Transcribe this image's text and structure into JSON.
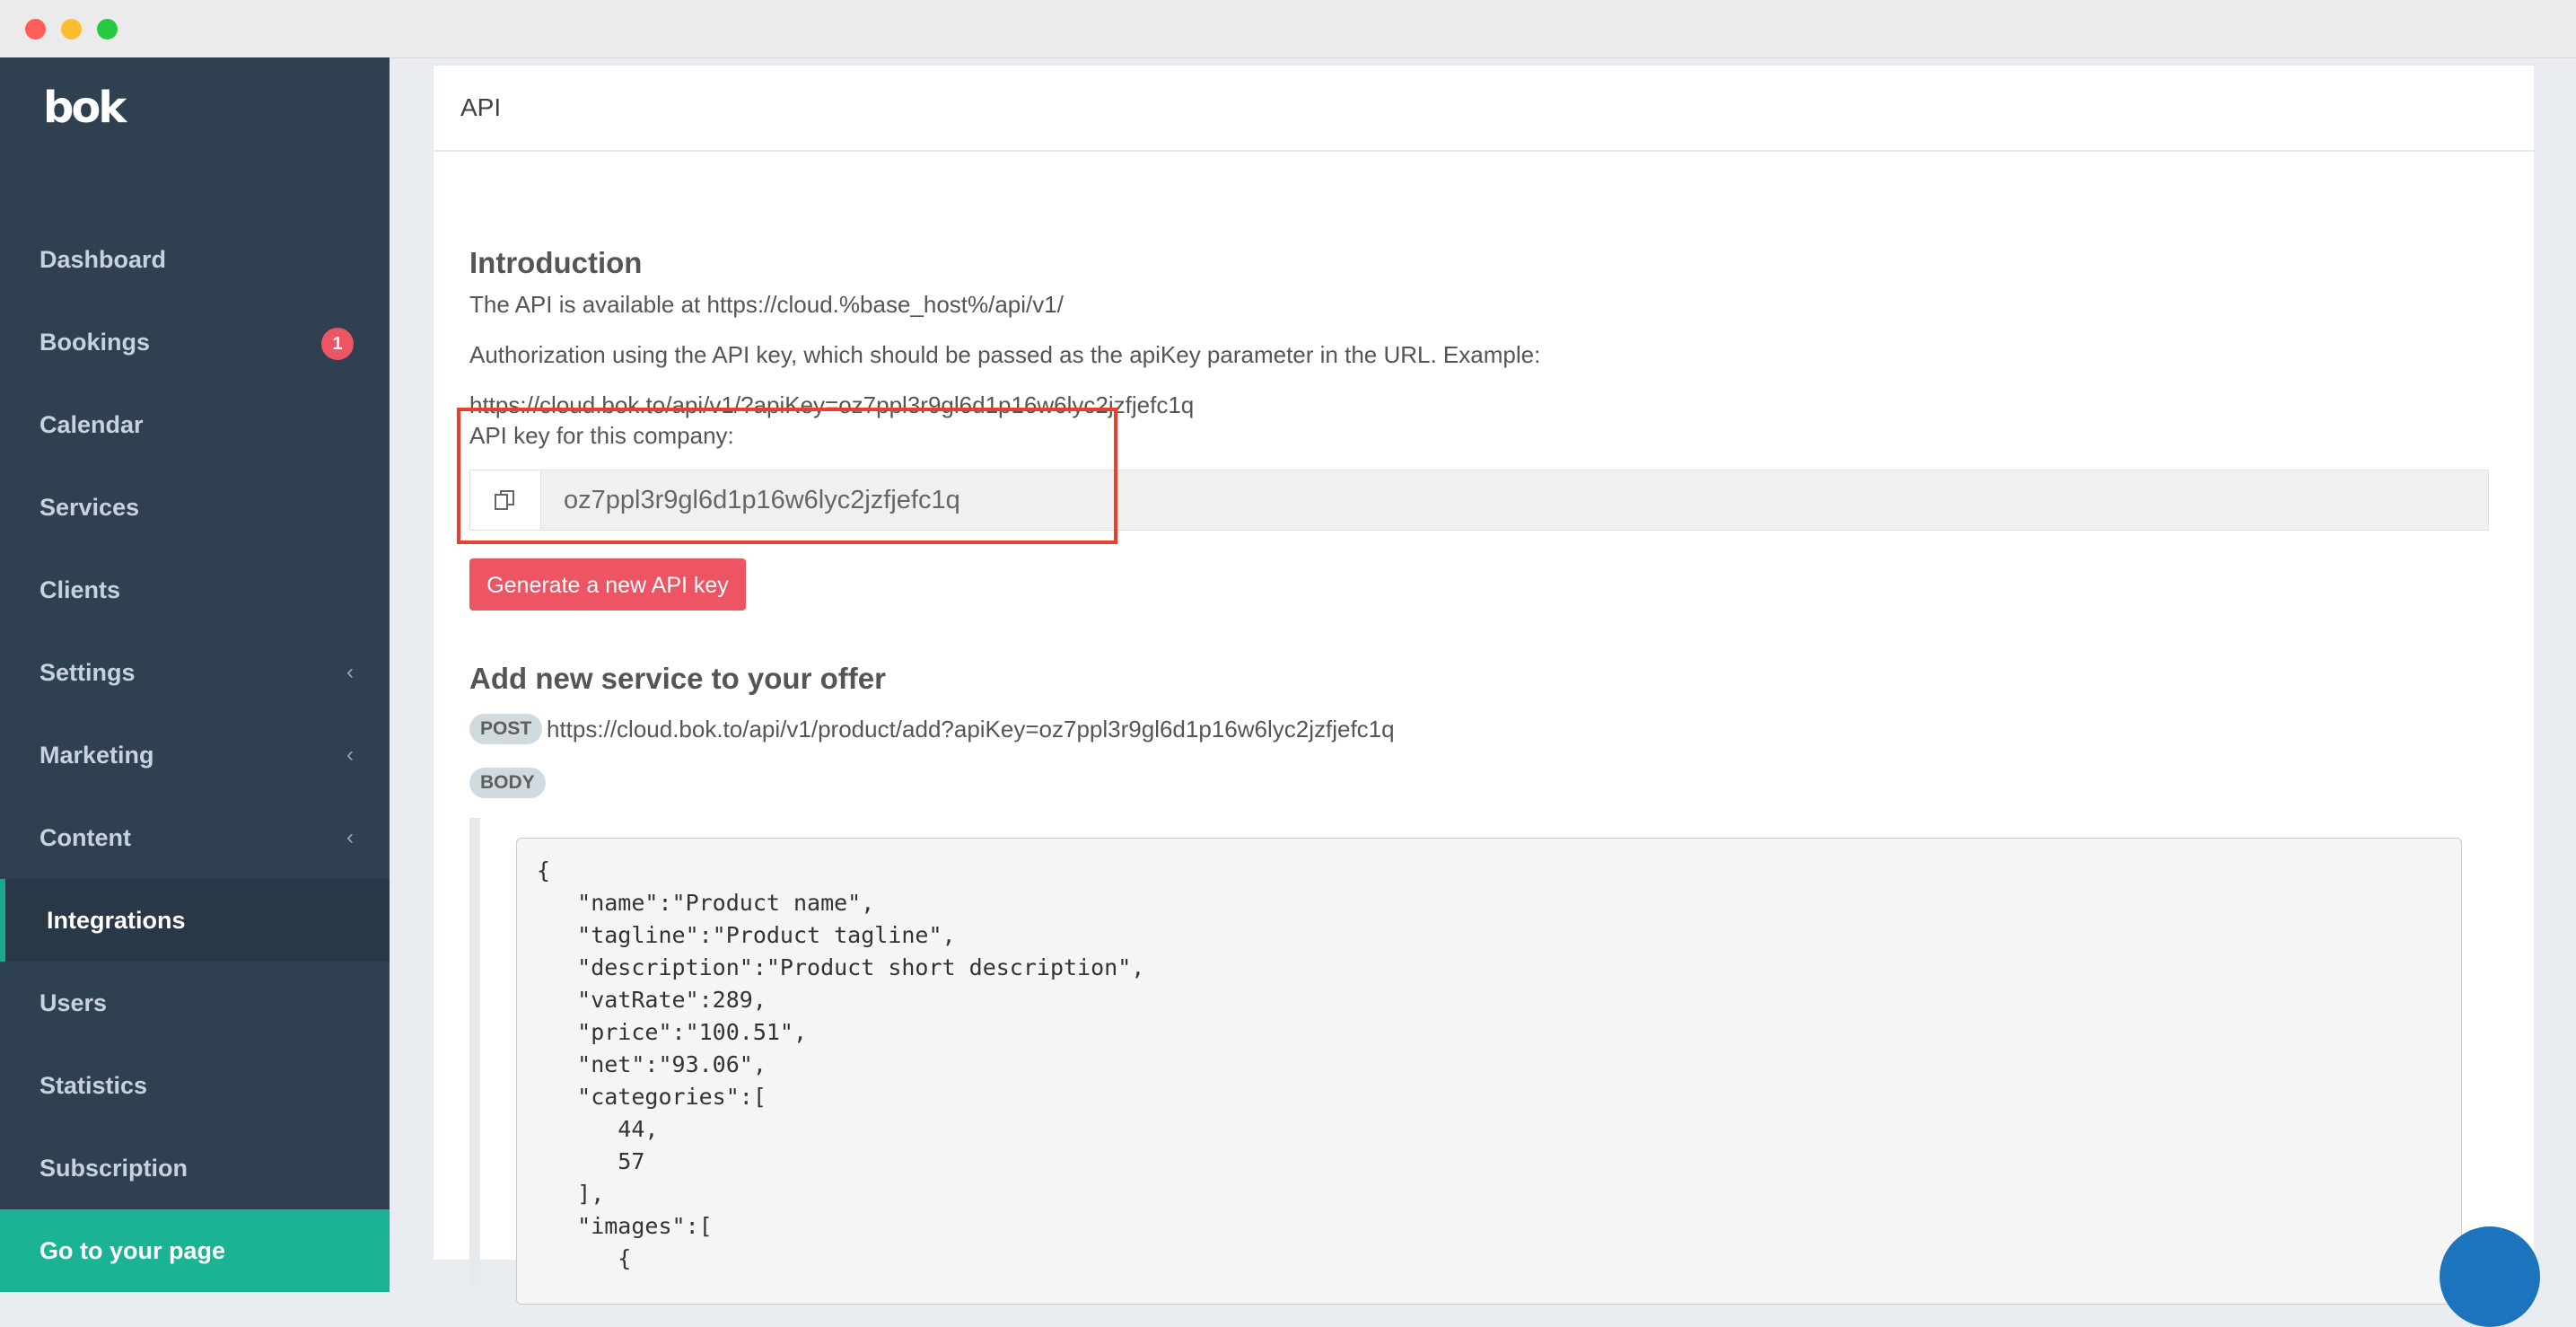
{
  "sidebar": {
    "logo": "bok",
    "items": [
      {
        "label": "Dashboard"
      },
      {
        "label": "Bookings",
        "badge": "1"
      },
      {
        "label": "Calendar"
      },
      {
        "label": "Services"
      },
      {
        "label": "Clients"
      },
      {
        "label": "Settings",
        "chevron": "‹"
      },
      {
        "label": "Marketing",
        "chevron": "‹"
      },
      {
        "label": "Content",
        "chevron": "‹"
      },
      {
        "label": "Integrations",
        "active": true
      },
      {
        "label": "Users"
      },
      {
        "label": "Statistics"
      },
      {
        "label": "Subscription"
      }
    ],
    "cta_label": "Go to your page"
  },
  "panel": {
    "title": "API"
  },
  "intro": {
    "heading": "Introduction",
    "line1": "The API is available at https://cloud.%base_host%/api/v1/",
    "line2": "Authorization using the API key, which should be passed as the apiKey parameter in the URL. Example:",
    "example_url": "https://cloud.bok.to/api/v1/?apiKey=oz7ppl3r9gl6d1p16w6lyc2jzfjefc1q"
  },
  "api_key": {
    "label": "API key for this company:",
    "value": "oz7ppl3r9gl6d1p16w6lyc2jzfjefc1q",
    "copy_icon": "copy-icon",
    "generate_label": "Generate a new API key"
  },
  "add_service": {
    "heading": "Add new service to your offer",
    "method": "POST",
    "url": "https://cloud.bok.to/api/v1/product/add?apiKey=oz7ppl3r9gl6d1p16w6lyc2jzfjefc1q",
    "body_label": "BODY",
    "body_code": "{\n   \"name\":\"Product name\",\n   \"tagline\":\"Product tagline\",\n   \"description\":\"Product short description\",\n   \"vatRate\":289,\n   \"price\":\"100.51\",\n   \"net\":\"93.06\",\n   \"categories\":[\n      44,\n      57\n   ],\n   \"images\":[\n      {"
  },
  "colors": {
    "sidebar_bg": "#2f4050",
    "accent": "#1ab394",
    "danger": "#ed5565",
    "highlight_border": "#e8402c"
  }
}
